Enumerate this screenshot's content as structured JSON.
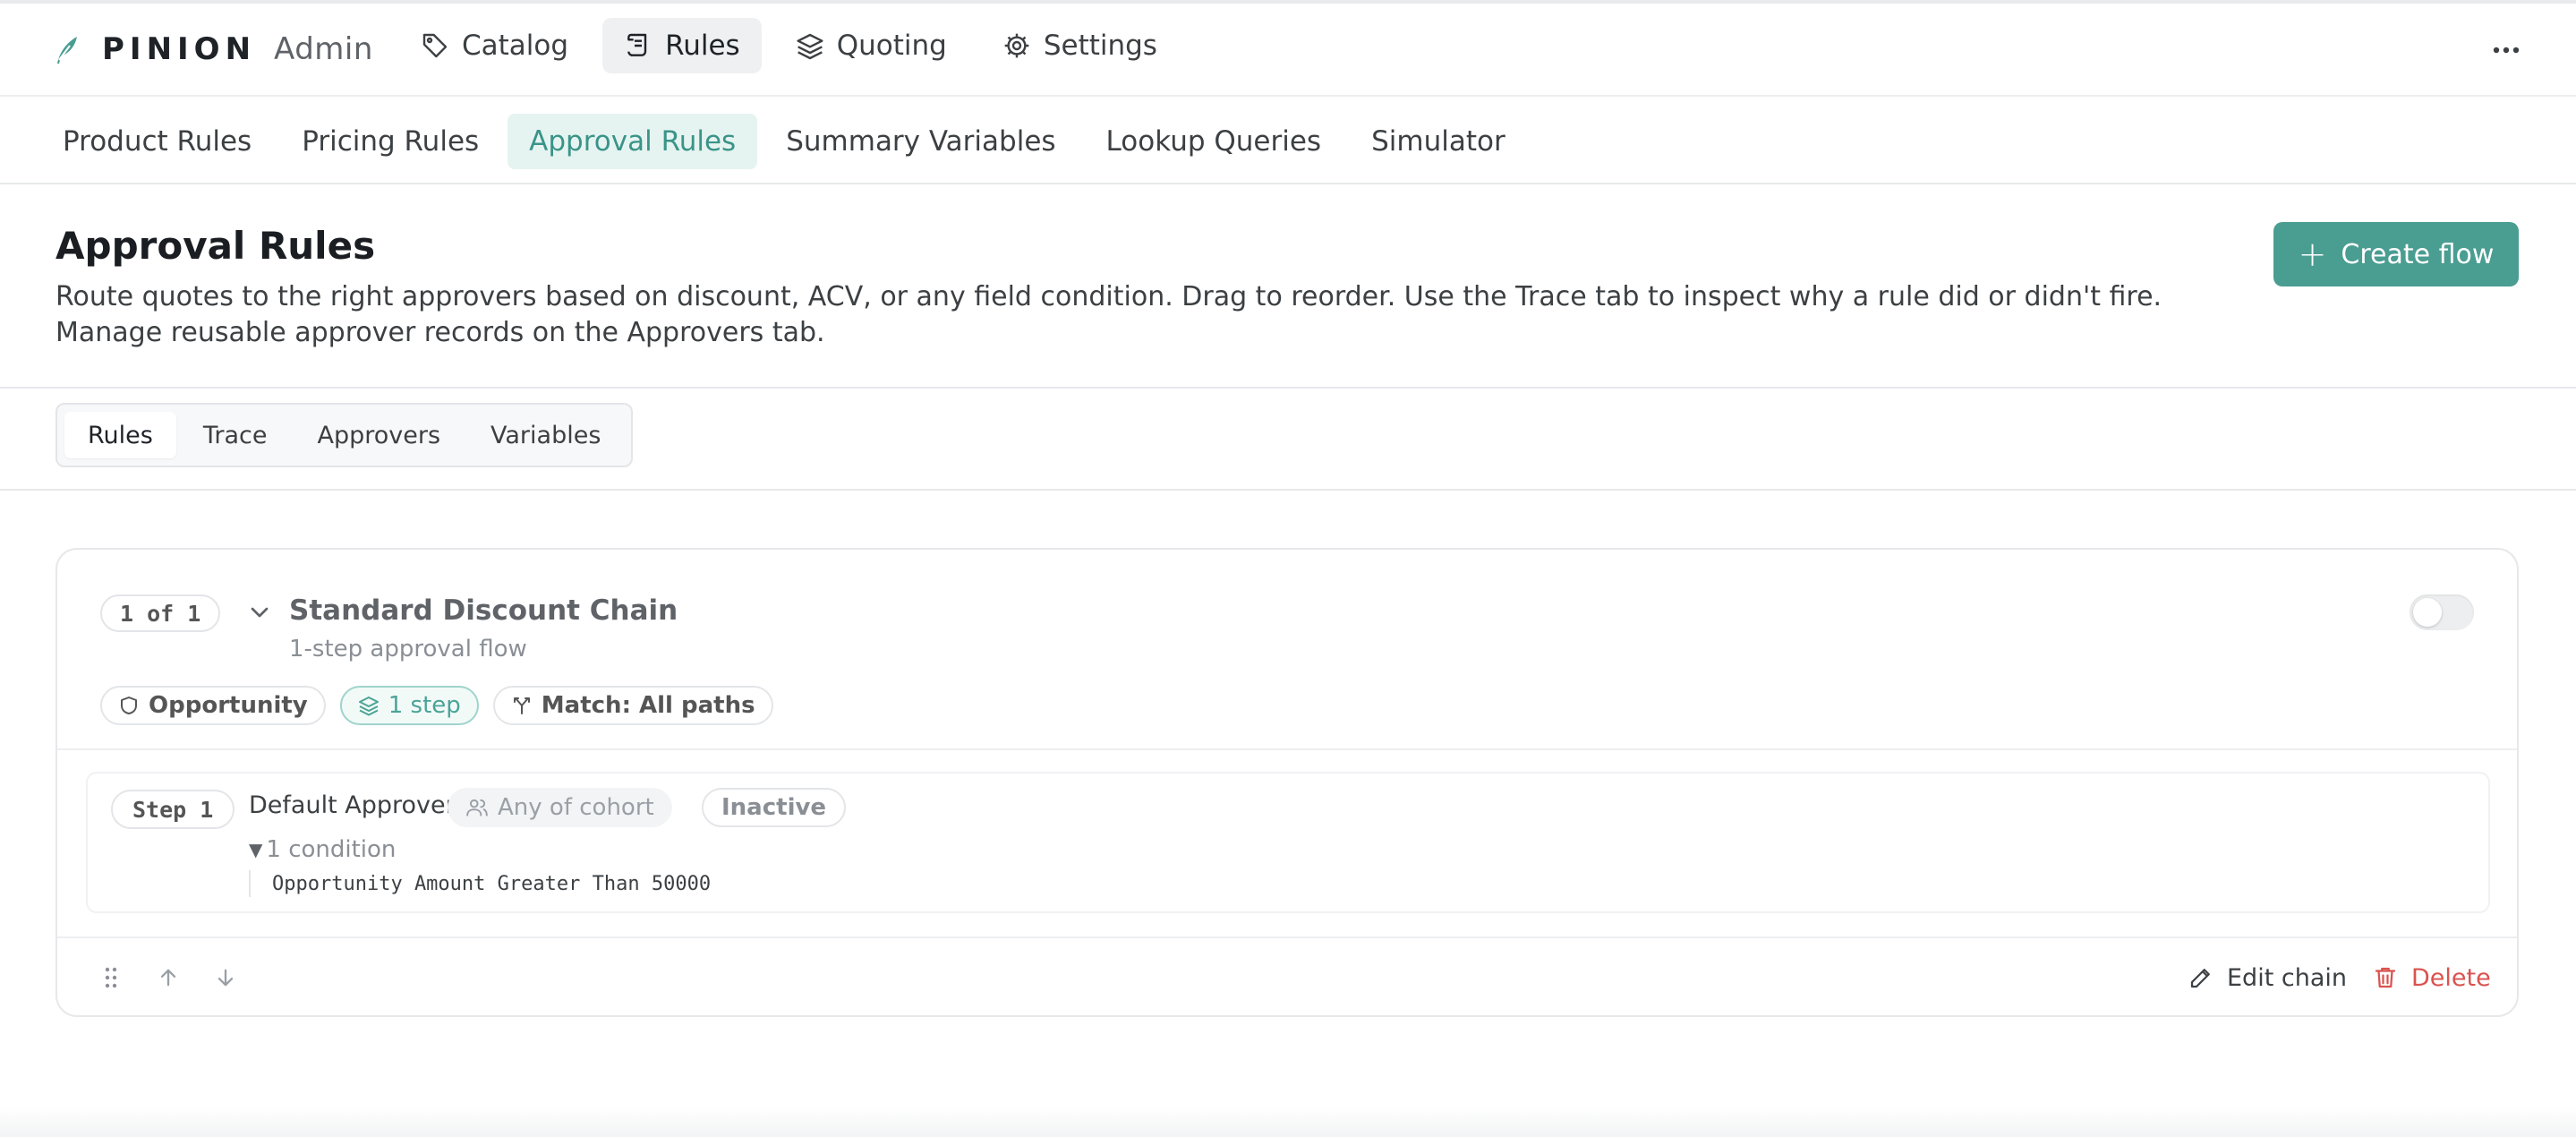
{
  "app": {
    "brand_name": "PINION",
    "brand_sub": "Admin"
  },
  "mainnav": {
    "items": [
      {
        "label": "Catalog",
        "icon": "tag-icon"
      },
      {
        "label": "Rules",
        "icon": "scroll-icon",
        "active": true
      },
      {
        "label": "Quoting",
        "icon": "layers-icon"
      },
      {
        "label": "Settings",
        "icon": "gear-icon"
      }
    ]
  },
  "subtabs": {
    "items": [
      {
        "label": "Product Rules"
      },
      {
        "label": "Pricing Rules"
      },
      {
        "label": "Approval Rules",
        "active": true
      },
      {
        "label": "Summary Variables"
      },
      {
        "label": "Lookup Queries"
      },
      {
        "label": "Simulator"
      }
    ]
  },
  "header": {
    "title": "Approval Rules",
    "description": "Route quotes to the right approvers based on discount, ACV, or any field condition. Drag to reorder. Use the Trace tab to inspect why a rule did or didn't fire. Manage reusable approver records on the Approvers tab.",
    "create_label": "Create flow"
  },
  "segmented": {
    "items": [
      {
        "label": "Rules",
        "active": true
      },
      {
        "label": "Trace"
      },
      {
        "label": "Approvers"
      },
      {
        "label": "Variables"
      }
    ]
  },
  "chain": {
    "position": "1 of 1",
    "title": "Standard Discount Chain",
    "subtitle": "1-step approval flow",
    "enabled": false,
    "badges": {
      "object": "Opportunity",
      "steps": "1 step",
      "match": "Match: All paths"
    },
    "step": {
      "label": "Step 1",
      "name": "Default Approver",
      "mode": "Any of cohort",
      "status": "Inactive",
      "conditions_label": "1 condition",
      "condition_expr": "Opportunity Amount Greater Than 50000"
    },
    "actions": {
      "edit": "Edit chain",
      "delete": "Delete"
    }
  },
  "colors": {
    "accent": "#4a9d91",
    "accent_light": "#e6f4f1",
    "danger": "#d9534f"
  }
}
